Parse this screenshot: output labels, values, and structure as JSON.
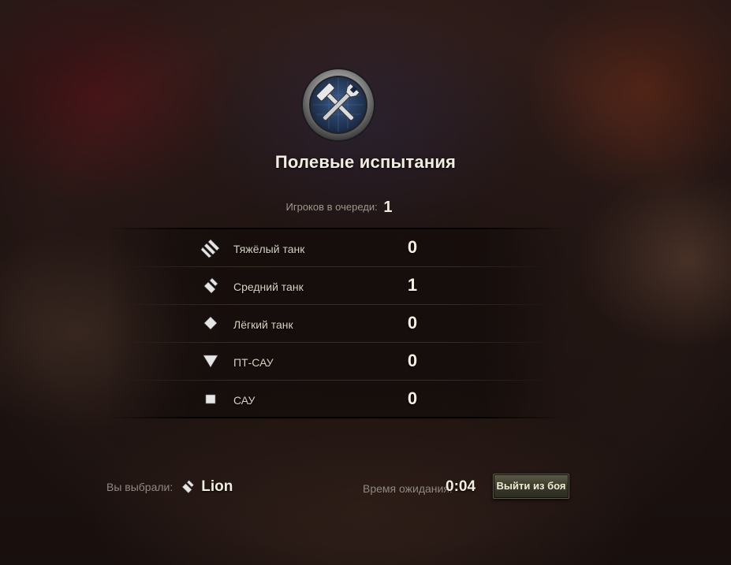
{
  "mode": {
    "title": "Полевые испытания",
    "emblem_icon": "hammer-wrench-emblem-icon"
  },
  "queue": {
    "label": "Игроков в очереди:",
    "count": "1"
  },
  "tank_types": [
    {
      "icon": "heavy-tank-icon",
      "label": "Тяжёлый танк",
      "count": "0"
    },
    {
      "icon": "medium-tank-icon",
      "label": "Средний танк",
      "count": "1"
    },
    {
      "icon": "light-tank-icon",
      "label": "Лёгкий танк",
      "count": "0"
    },
    {
      "icon": "tank-destroyer-icon",
      "label": "ПТ-САУ",
      "count": "0"
    },
    {
      "icon": "spg-icon",
      "label": "САУ",
      "count": "0"
    }
  ],
  "selection": {
    "label": "Вы выбрали:",
    "vehicle_icon": "medium-tank-icon",
    "vehicle": "Lion"
  },
  "waiting": {
    "label": "Время ожидания:",
    "time": "0:04"
  },
  "exit_button": {
    "label": "Выйти из боя"
  },
  "colors": {
    "accent_text": "#f2ede0",
    "muted_text": "#8f897f",
    "button": "#4a4a38"
  }
}
